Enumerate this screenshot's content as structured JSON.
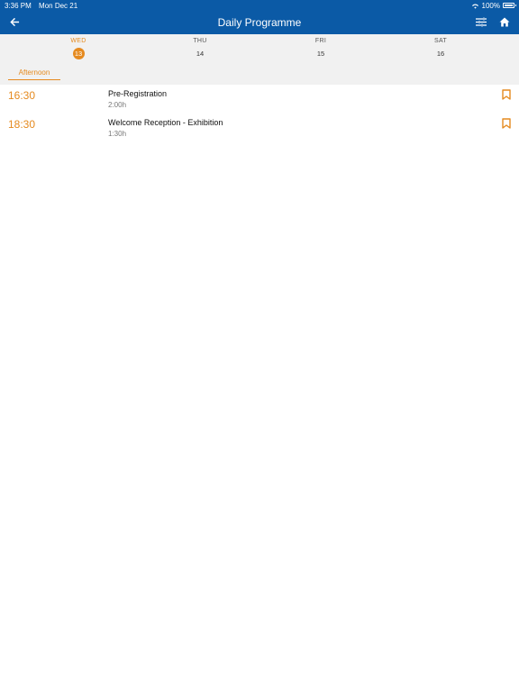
{
  "status": {
    "time": "3:36 PM",
    "date": "Mon Dec 21",
    "battery": "100%"
  },
  "nav": {
    "title": "Daily Programme"
  },
  "days": [
    {
      "name": "WED",
      "num": "13",
      "active": true
    },
    {
      "name": "THU",
      "num": "14",
      "active": false
    },
    {
      "name": "FRI",
      "num": "15",
      "active": false
    },
    {
      "name": "SAT",
      "num": "16",
      "active": false
    }
  ],
  "segment": {
    "label": "Afternoon"
  },
  "sessions": [
    {
      "time": "16:30",
      "title": "Pre-Registration",
      "duration": "2:00h"
    },
    {
      "time": "18:30",
      "title": "Welcome Reception - Exhibition",
      "duration": "1:30h"
    }
  ],
  "colors": {
    "header": "#0b5aa6",
    "accent": "#e58a1f",
    "strip": "#f1f1f1"
  }
}
